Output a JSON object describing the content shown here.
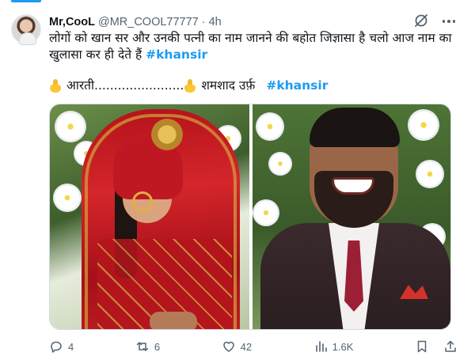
{
  "tweet": {
    "author": {
      "display_name": "Mr,CooL",
      "handle": "@MR_COOL77777",
      "separator": "·",
      "time": "4h"
    },
    "text": "लोगों को खान सर और उनकी पत्नी का नाम जानने की बहोत जिज्ञासा है चलो आज नाम का खुलासा कर ही देते हैं",
    "hashtag": "#khansir",
    "names_line": {
      "first_icon": "backhand-index-pointing-down-icon",
      "first_text": "आरती.......................",
      "second_icon": "backhand-index-pointing-down-icon",
      "second_text": "शमशाद उर्फ़",
      "second_hashtag": "#khansir"
    },
    "media": {
      "photos": [
        "bride-in-red-veil-photo",
        "smiling-man-in-suit-photo"
      ]
    },
    "actions": {
      "replies": "4",
      "reposts": "6",
      "likes": "42",
      "views": "1.6K"
    }
  },
  "colors": {
    "accent": "#1d9bf0",
    "text": "#0f1419",
    "muted": "#536471",
    "border": "#cfd9de"
  }
}
